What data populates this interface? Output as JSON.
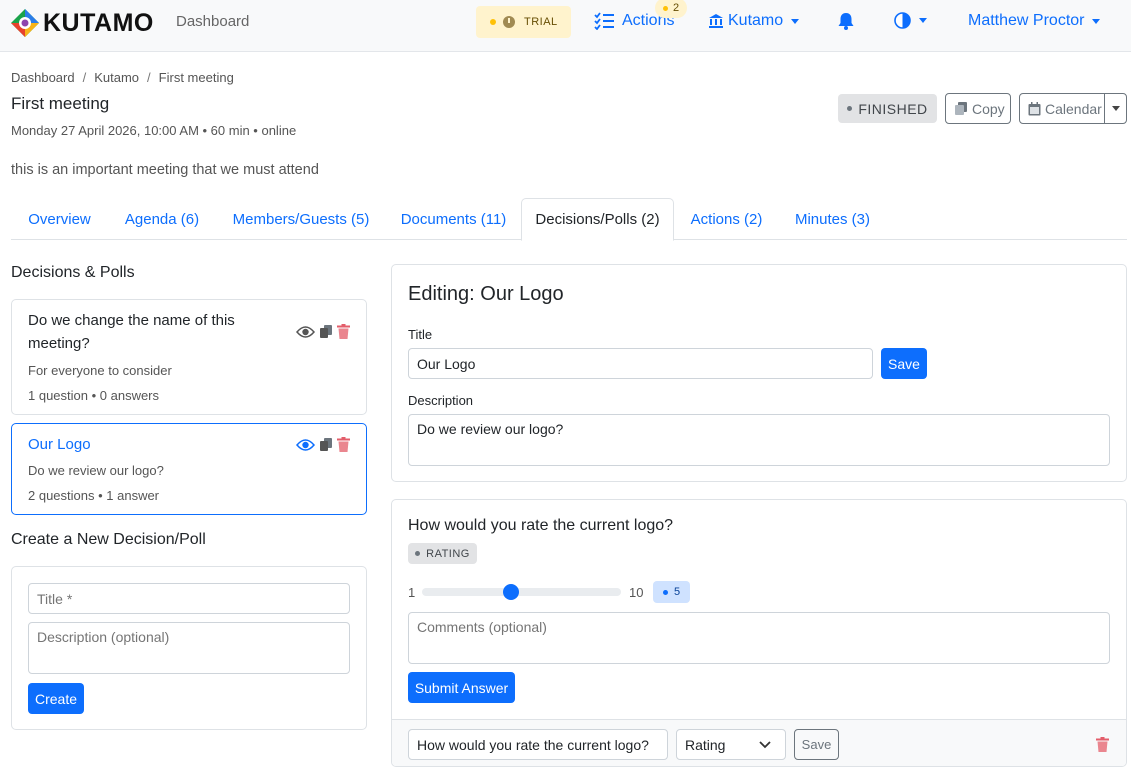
{
  "navbar": {
    "brand": "KUTAMO",
    "dashboard_link": "Dashboard",
    "trial_label": "TRIAL",
    "actions_label": "Actions",
    "actions_count": "2",
    "org_label": "Kutamo",
    "user_name": "Matthew Proctor"
  },
  "breadcrumb": [
    "Dashboard",
    "Kutamo",
    "First meeting"
  ],
  "meeting": {
    "title": "First meeting",
    "meta": "Monday 27 April 2026, 10:00 AM • 60 min • online",
    "description": "this is an important meeting that we must attend",
    "status": "FINISHED",
    "copy_label": "Copy",
    "calendar_label": "Calendar"
  },
  "tabs": [
    {
      "label": "Overview"
    },
    {
      "label": "Agenda (6)"
    },
    {
      "label": "Members/Guests (5)"
    },
    {
      "label": "Documents (11)"
    },
    {
      "label": "Decisions/Polls (2)"
    },
    {
      "label": "Actions (2)"
    },
    {
      "label": "Minutes (3)"
    }
  ],
  "left": {
    "section_title": "Decisions & Polls",
    "polls": [
      {
        "title": "Do we change the name of this meeting?",
        "description": "For everyone to consider",
        "meta": "1 question • 0 answers"
      },
      {
        "title": "Our Logo",
        "description": "Do we review our logo?",
        "meta": "2 questions • 1 answer"
      }
    ],
    "create_title": "Create a New Decision/Poll",
    "create_title_placeholder": "Title *",
    "create_desc_placeholder": "Description (optional)",
    "create_button": "Create"
  },
  "editor": {
    "heading": "Editing: Our Logo",
    "title_label": "Title",
    "title_value": "Our Logo",
    "save_label": "Save",
    "description_label": "Description",
    "description_value": "Do we review our logo?"
  },
  "question": {
    "title": "How would you rate the current logo?",
    "type_badge": "RATING",
    "min": "1",
    "max": "10",
    "value": "5",
    "comments_placeholder": "Comments (optional)",
    "submit_label": "Submit Answer",
    "edit_question_value": "How would you rate the current logo?",
    "type_select": "Rating",
    "save_label": "Save"
  },
  "colors": {
    "primary": "#0d6efd",
    "danger_icon": "#e35d6a",
    "trial_bg": "#fff3cd"
  }
}
